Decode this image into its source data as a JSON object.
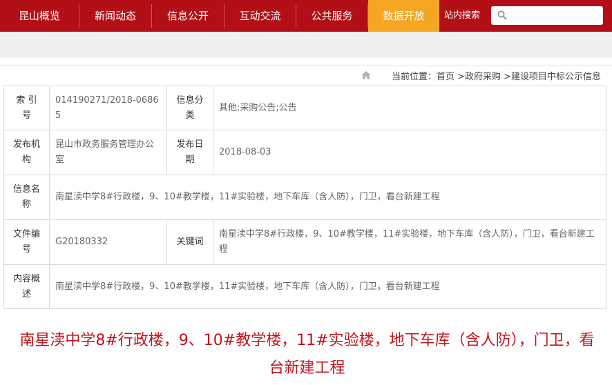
{
  "nav": {
    "items": [
      {
        "label": "昆山概览"
      },
      {
        "label": "新闻动态"
      },
      {
        "label": "信息公开"
      },
      {
        "label": "互动交流"
      },
      {
        "label": "公共服务"
      },
      {
        "label": "数据开放"
      }
    ],
    "search_label": "站内搜索",
    "search_placeholder": "",
    "active_index": 5,
    "colors": {
      "bar": "#b30f16",
      "active": "#f5a623"
    }
  },
  "breadcrumb": {
    "text": "当前位置：首页 >政府采购 >建设项目中标公示信息",
    "icon": "home-icon"
  },
  "table": {
    "index_label": "索 引 号",
    "index_value": "014190271/2018-06865",
    "category_label": "信息分类",
    "category_value": "其他;采购公告;公告",
    "publisher_label": "发布机构",
    "publisher_value": "昆山市政务服务管理办公室",
    "date_label": "发布日期",
    "date_value": "2018-08-03",
    "name_label": "信息名称",
    "name_value": "南星渎中学8#行政楼，9、10#教学楼，11#实验楼，地下车库（含人防），门卫，看台新建工程",
    "fileno_label": "文件编号",
    "fileno_value": "G20180332",
    "keyword_label": "关键词",
    "keyword_value": "南星渎中学8#行政楼，9、10#教学楼，11#实验楼，地下车库（含人防），门卫，看台新建工程",
    "summary_label": "内容概述",
    "summary_value": "南星渎中学8#行政楼，9、10#教学楼，11#实验楼，地下车库（含人防），门卫，看台新建工程"
  },
  "headline": "南星渎中学8#行政楼，9、10#教学楼，11#实验楼，地下车库（含人防），门卫，看台新建工程",
  "colors": {
    "headline": "#c0141b"
  }
}
